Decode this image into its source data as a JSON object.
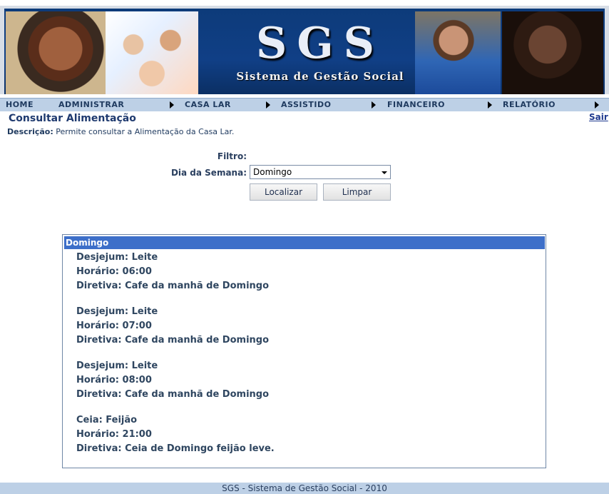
{
  "header": {
    "logo_title": "SGS",
    "logo_subtitle": "Sistema de Gestão Social"
  },
  "menu": [
    {
      "label": "HOME"
    },
    {
      "label": "ADMINISTRAR"
    },
    {
      "label": "CASA LAR"
    },
    {
      "label": "ASSISTIDO"
    },
    {
      "label": "FINANCEIRO"
    },
    {
      "label": "RELATÓRIO"
    }
  ],
  "page": {
    "title": "Consultar Alimentação",
    "description_label": "Descrição:",
    "description_text": "Permite consultar a Alimentação da Casa Lar.",
    "logout": "Sair"
  },
  "filter": {
    "heading": "Filtro:",
    "day_label": "Dia da Semana:",
    "day_value": "Domingo",
    "search_button": "Localizar",
    "clear_button": "Limpar"
  },
  "results": {
    "group_title": "Domingo",
    "items": [
      {
        "meal": "Desjejum: Leite",
        "time": "Horário: 06:00",
        "directive": "Diretiva: Cafe da manhã de Domingo"
      },
      {
        "meal": "Desjejum: Leite",
        "time": "Horário: 07:00",
        "directive": "Diretiva: Cafe da manhã de Domingo"
      },
      {
        "meal": "Desjejum: Leite",
        "time": "Horário: 08:00",
        "directive": "Diretiva: Cafe da manhã de Domingo"
      },
      {
        "meal": "Ceia: Feijão",
        "time": "Horário: 21:00",
        "directive": "Diretiva: Ceia de Domingo feijão leve."
      }
    ]
  },
  "footer": {
    "text": "SGS - Sistema de Gestão Social - 2010"
  }
}
